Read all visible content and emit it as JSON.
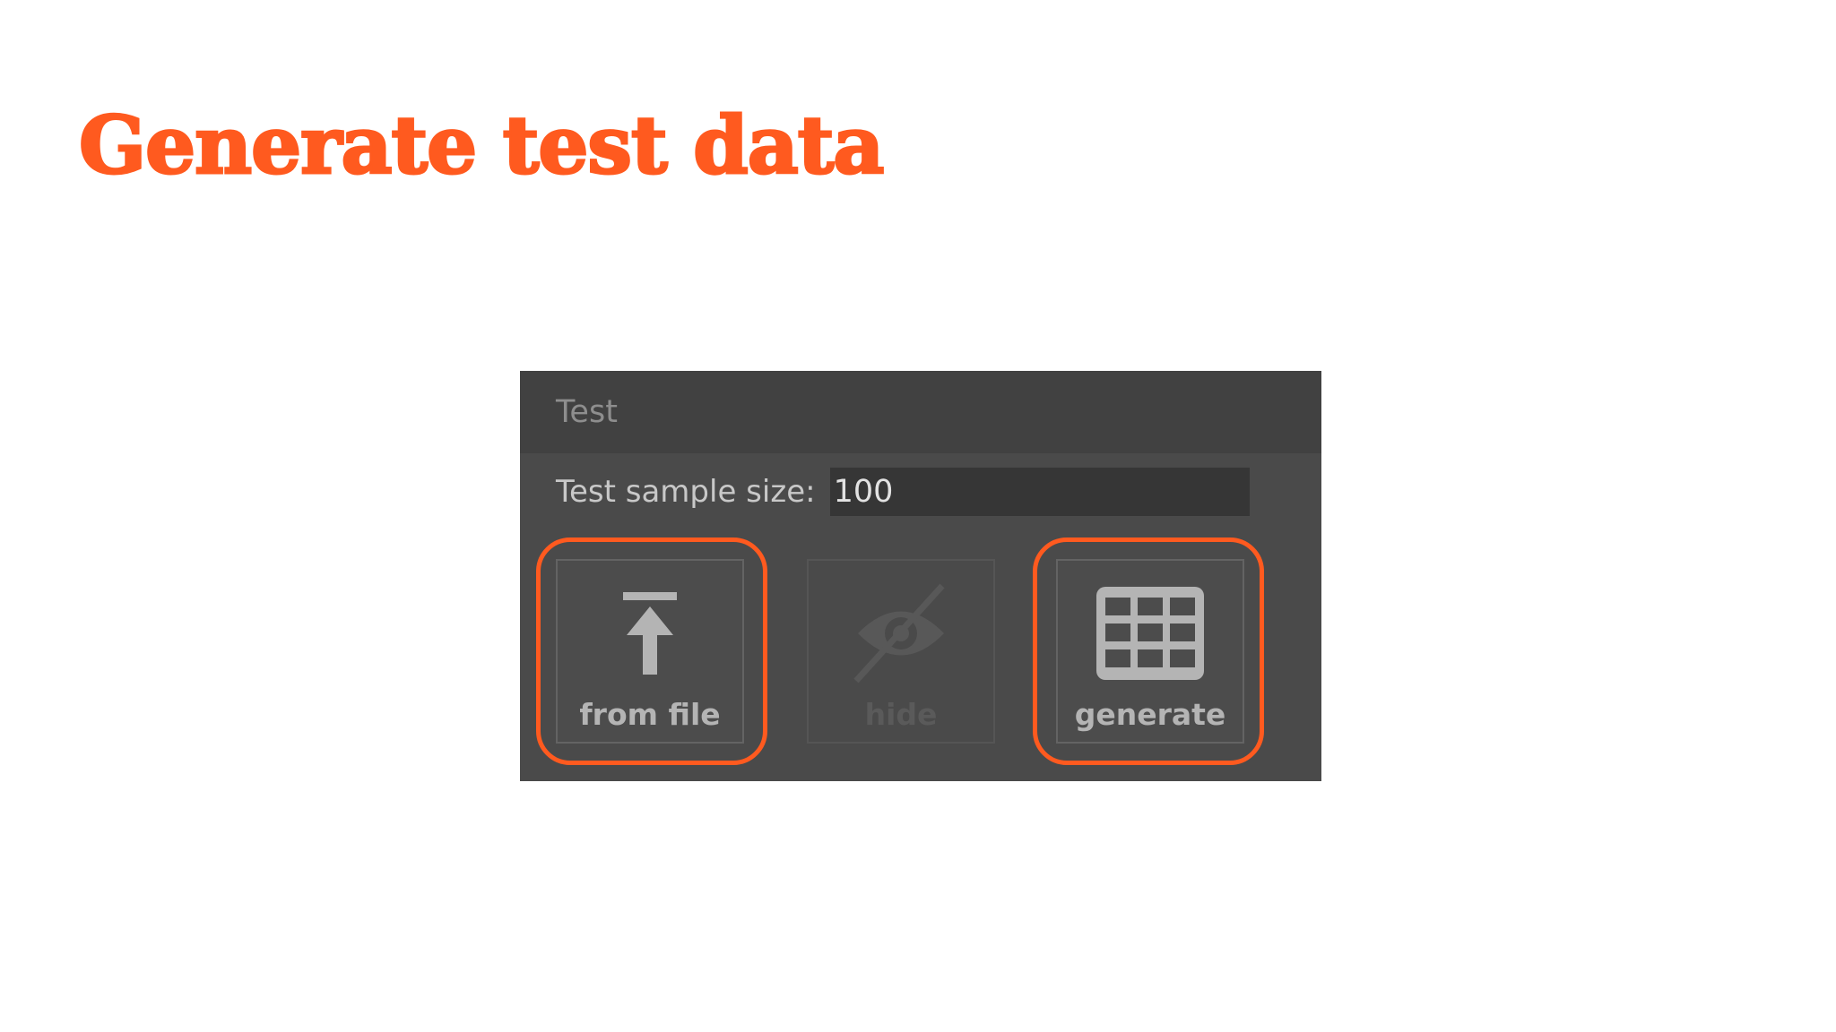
{
  "slide": {
    "title": "Generate test data",
    "accent_color": "#ff5a1f"
  },
  "panel": {
    "title": "Test",
    "sample_size_label": "Test sample size:",
    "sample_size_value": "100",
    "buttons": [
      {
        "label": "from file",
        "icon": "upload-arrow-icon",
        "enabled": true,
        "highlighted": true
      },
      {
        "label": "hide",
        "icon": "eye-hidden-icon",
        "enabled": false,
        "highlighted": false
      },
      {
        "label": "generate",
        "icon": "table-grid-icon",
        "enabled": true,
        "highlighted": true
      }
    ]
  }
}
